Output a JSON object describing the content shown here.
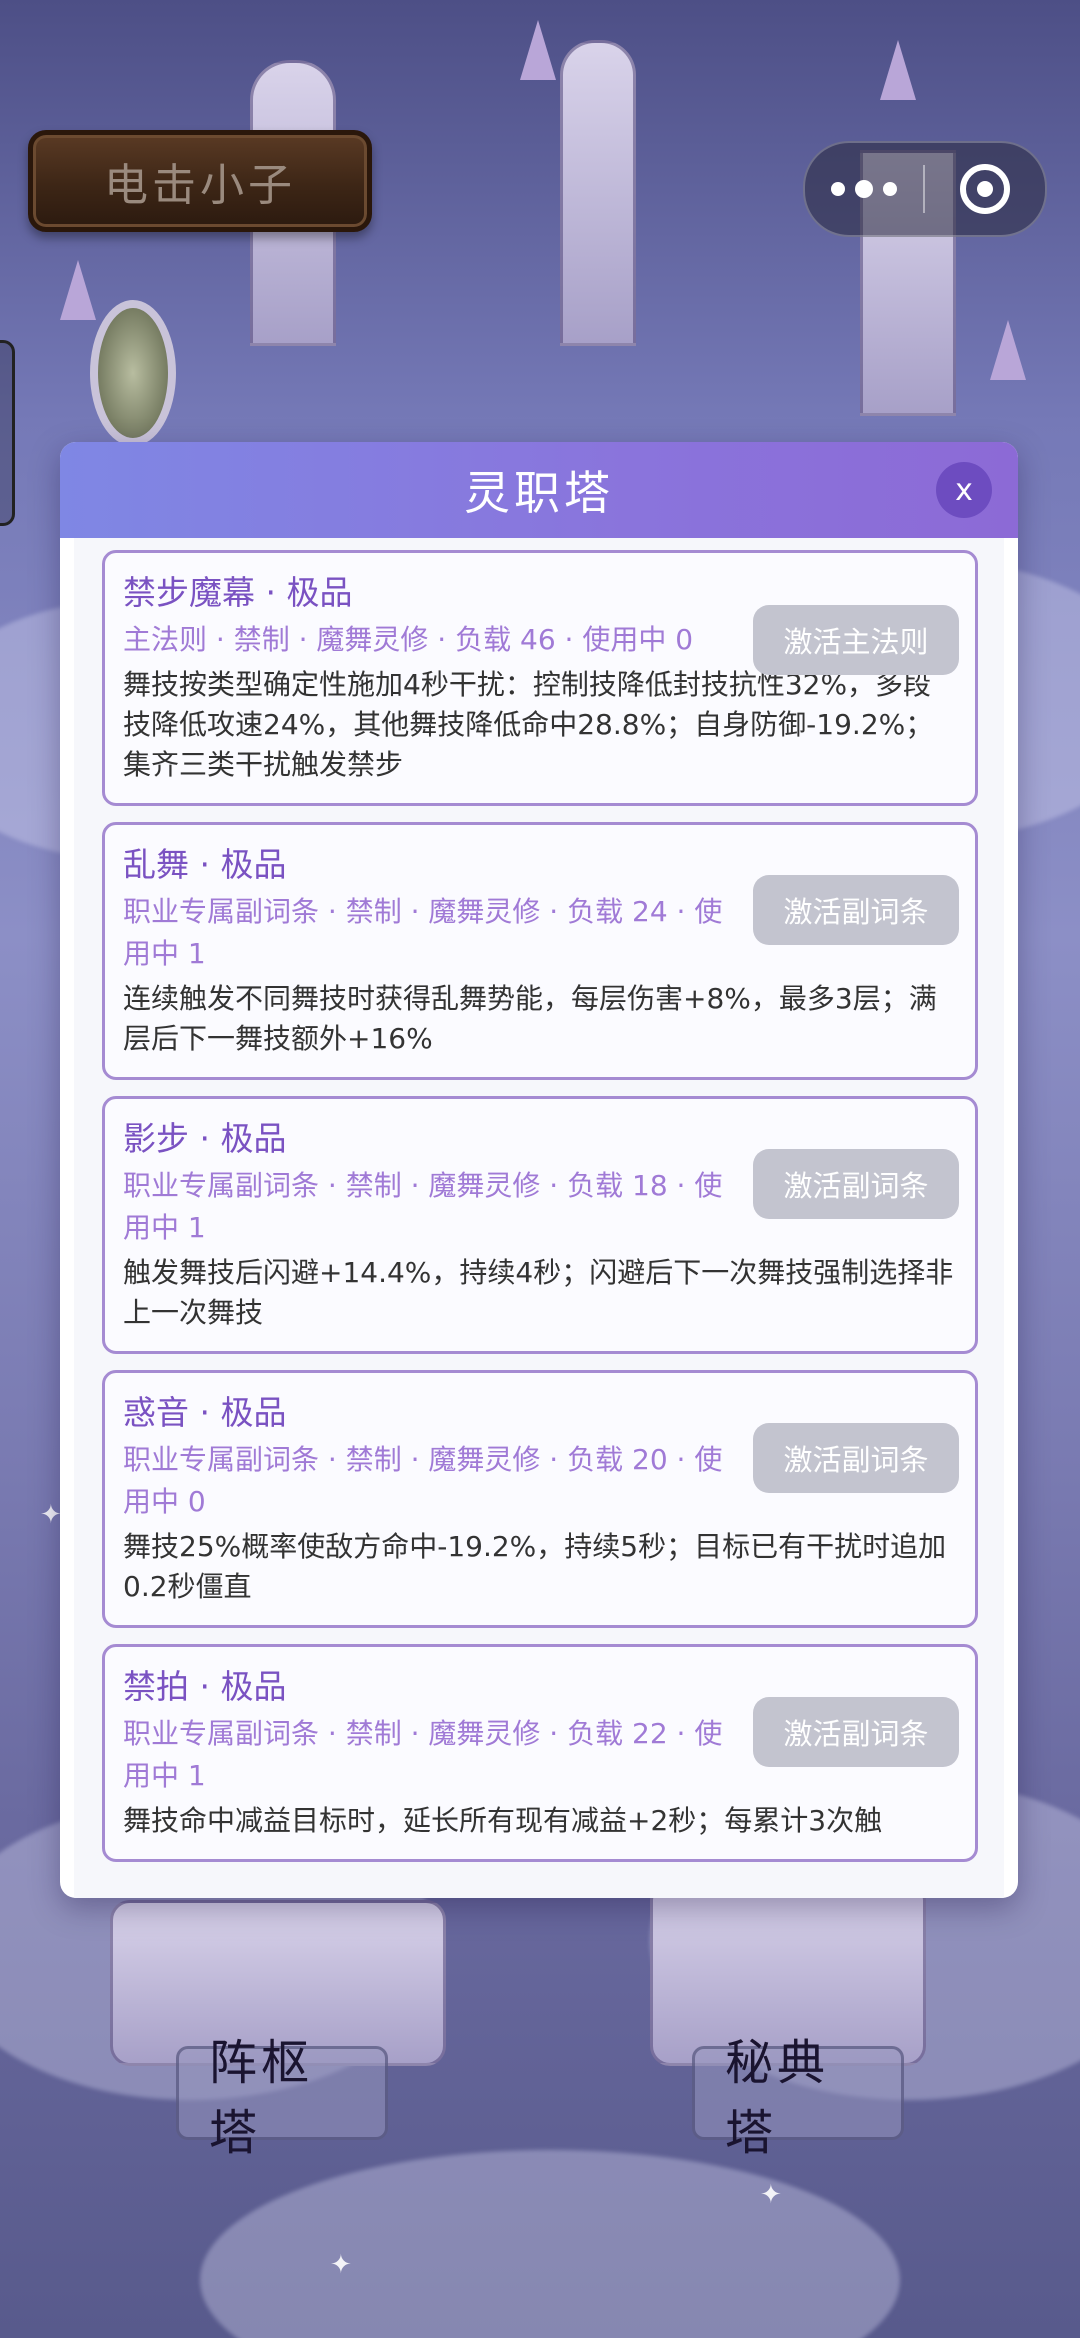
{
  "top_sign": {
    "label": "电击小子"
  },
  "modal": {
    "title": "灵职塔",
    "close_label": "x",
    "cards": [
      {
        "title": "禁步魔幕 · 极品",
        "meta": "主法则 · 禁制 · 魔舞灵修 · 负载 46 · 使用中 0",
        "desc": "舞技按类型确定性施加4秒干扰：控制技降低封技抗性32%，多段技降低攻速24%，其他舞技降低命中28.8%；自身防御-19.2%；集齐三类干扰触发禁步",
        "button": "激活主法则"
      },
      {
        "title": "乱舞 · 极品",
        "meta": "职业专属副词条 · 禁制 · 魔舞灵修 · 负载 24 · 使用中 1",
        "desc": "连续触发不同舞技时获得乱舞势能，每层伤害+8%，最多3层；满层后下一舞技额外+16%",
        "button": "激活副词条"
      },
      {
        "title": "影步 · 极品",
        "meta": "职业专属副词条 · 禁制 · 魔舞灵修 · 负载 18 · 使用中 1",
        "desc": "触发舞技后闪避+14.4%，持续4秒；闪避后下一次舞技强制选择非上一次舞技",
        "button": "激活副词条"
      },
      {
        "title": "惑音 · 极品",
        "meta": "职业专属副词条 · 禁制 · 魔舞灵修 · 负载 20 · 使用中 0",
        "desc": "舞技25%概率使敌方命中-19.2%，持续5秒；目标已有干扰时追加0.2秒僵直",
        "button": "激活副词条"
      },
      {
        "title": "禁拍 · 极品",
        "meta": "职业专属副词条 · 禁制 · 魔舞灵修 · 负载 22 · 使用中 1",
        "desc": "舞技命中减益目标时，延长所有现有减益+2秒；每累计3次触",
        "button": "激活副词条"
      }
    ]
  },
  "bottom_buttons": {
    "left": "阵枢塔",
    "right": "秘典塔"
  },
  "colors": {
    "header_start": "#7f87e4",
    "header_end": "#8c6ad6",
    "card_border": "#a58bd2",
    "button_disabled": "#c3c4cf"
  }
}
